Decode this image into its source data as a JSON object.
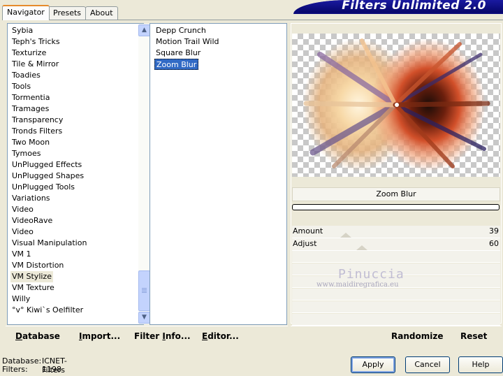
{
  "tabs": [
    "Navigator",
    "Presets",
    "About"
  ],
  "banner": "Filters Unlimited 2.0",
  "categories": [
    "Sybia",
    "Teph's Tricks",
    "Texturize",
    "Tile & Mirror",
    "Toadies",
    "Tools",
    "Tormentia",
    "Tramages",
    "Transparency",
    "Tronds Filters",
    "Two Moon",
    "Tymoes",
    "UnPlugged Effects",
    "UnPlugged Shapes",
    "UnPlugged Tools",
    "Variations",
    "Video",
    "VideoRave",
    "Video",
    "Visual Manipulation",
    "VM 1",
    "VM Distortion",
    "VM Stylize",
    "VM Texture",
    "Willy",
    "°v° Kiwi`s Oelfilter"
  ],
  "selected_category": "VM Stylize",
  "filters": [
    "Depp Crunch",
    "Motion Trail Wild",
    "Square Blur",
    "Zoom Blur"
  ],
  "selected_filter": "Zoom Blur",
  "preview": {
    "filter_name": "Zoom Blur"
  },
  "params": [
    {
      "label": "Amount",
      "value": "39",
      "level": 39
    },
    {
      "label": "Adjust",
      "value": "60",
      "level": 60
    }
  ],
  "watermark": {
    "name": "Pinuccia",
    "site": "www.maidiregrafica.eu"
  },
  "left_buttons": [
    {
      "first": "D",
      "rest": "atabase"
    },
    {
      "first": "I",
      "rest": "mport..."
    },
    {
      "first": "Filter ",
      "rest": "I",
      "tail": "nfo..."
    },
    {
      "first": "E",
      "rest": "ditor..."
    }
  ],
  "right_buttons": [
    "Randomize",
    "Reset"
  ],
  "status": {
    "database_label": "Database:",
    "database_value": "ICNET-Filters",
    "filters_label": "Filters:",
    "filters_value": "1198"
  },
  "dialog_buttons": [
    "Apply",
    "Cancel",
    "Help"
  ],
  "colors": {
    "selection": "#316ac5",
    "banner": "#0a0a7a",
    "tab_accent": "#e68b2c"
  }
}
